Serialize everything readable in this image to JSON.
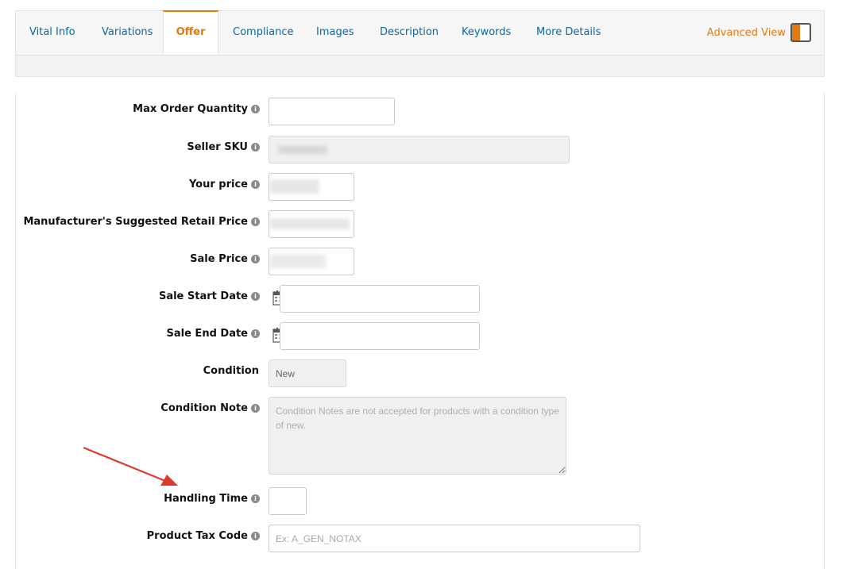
{
  "tabs": [
    {
      "label": "Vital Info",
      "active": false
    },
    {
      "label": "Variations",
      "active": false
    },
    {
      "label": "Offer",
      "active": true
    },
    {
      "label": "Compliance",
      "active": false
    },
    {
      "label": "Images",
      "active": false
    },
    {
      "label": "Description",
      "active": false
    },
    {
      "label": "Keywords",
      "active": false
    },
    {
      "label": "More Details",
      "active": false
    }
  ],
  "advanced_view": {
    "label": "Advanced View",
    "enabled": true
  },
  "form": {
    "max_order_quantity": {
      "label": "Max Order Quantity",
      "value": ""
    },
    "seller_sku": {
      "label": "Seller SKU",
      "value": ""
    },
    "your_price": {
      "label": "Your price",
      "value": ""
    },
    "msrp": {
      "label": "Manufacturer's Suggested Retail Price",
      "value": ""
    },
    "sale_price": {
      "label": "Sale Price",
      "value": ""
    },
    "sale_start_date": {
      "label": "Sale Start Date",
      "value": ""
    },
    "sale_end_date": {
      "label": "Sale End Date",
      "value": ""
    },
    "condition": {
      "label": "Condition",
      "value": "New"
    },
    "condition_note": {
      "label": "Condition Note",
      "placeholder": "Condition Notes are not accepted for products with a condition type of new."
    },
    "handling_time": {
      "label": "Handling Time",
      "value": ""
    },
    "product_tax_code": {
      "label": "Product Tax Code",
      "placeholder": "Ex: A_GEN_NOTAX"
    }
  },
  "icons": {
    "info": "info-icon",
    "calendar": "calendar-icon",
    "arrow": "arrow-annotation-icon"
  },
  "colors": {
    "accent": "#e47911",
    "link": "#0a6aa1",
    "arrow": "#e0382b"
  }
}
